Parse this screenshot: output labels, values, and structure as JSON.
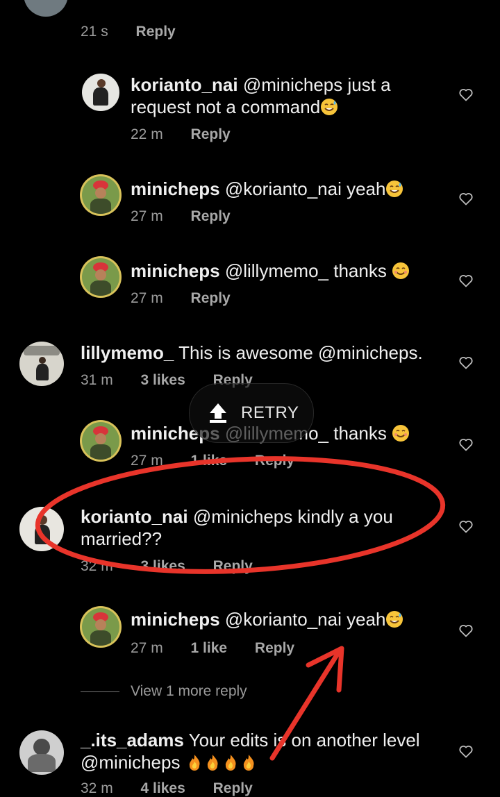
{
  "top_meta": {
    "time": "21 s",
    "reply": "Reply"
  },
  "comments": [
    {
      "user": "korianto_nai",
      "text": " @minicheps just a request not a command",
      "emoji": "sweat-smile",
      "time": "22 m",
      "likes": "",
      "reply": "Reply"
    },
    {
      "user": "minicheps",
      "text": " @korianto_nai yeah",
      "emoji": "sweat-smile",
      "time": "27 m",
      "likes": "",
      "reply": "Reply"
    },
    {
      "user": "minicheps",
      "text": " @lillymemo_ thanks ",
      "emoji": "smile",
      "time": "27 m",
      "likes": "",
      "reply": "Reply"
    },
    {
      "user": "lillymemo_",
      "text": " This is awesome @minicheps.",
      "time": "31 m",
      "likes": "3 likes",
      "reply": "Reply"
    },
    {
      "user": "minicheps",
      "text": " @lillymemo_ thanks ",
      "emoji": "smile",
      "time": "27 m",
      "likes": "1 like",
      "reply": "Reply"
    },
    {
      "user": "korianto_nai",
      "text": " @minicheps  kindly a you married??",
      "time": "32 m",
      "likes": "3 likes",
      "reply": "Reply"
    },
    {
      "user": "minicheps",
      "text": " @korianto_nai yeah",
      "emoji": "sweat-smile",
      "time": "27 m",
      "likes": "1 like",
      "reply": "Reply"
    },
    {
      "user": "_.its_adams",
      "text": " Your edits is on another level @minicheps ",
      "emoji": "fire x4",
      "time": "32 m",
      "likes": "4 likes",
      "reply": "Reply"
    }
  ],
  "retry_label": "RETRY",
  "view_more": "View 1 more reply",
  "annotation_colors": {
    "circle": "#e8342a",
    "arrow": "#e8342a"
  },
  "icons": {
    "like": "heart-outline-icon",
    "retry": "upload-arrow-icon"
  }
}
